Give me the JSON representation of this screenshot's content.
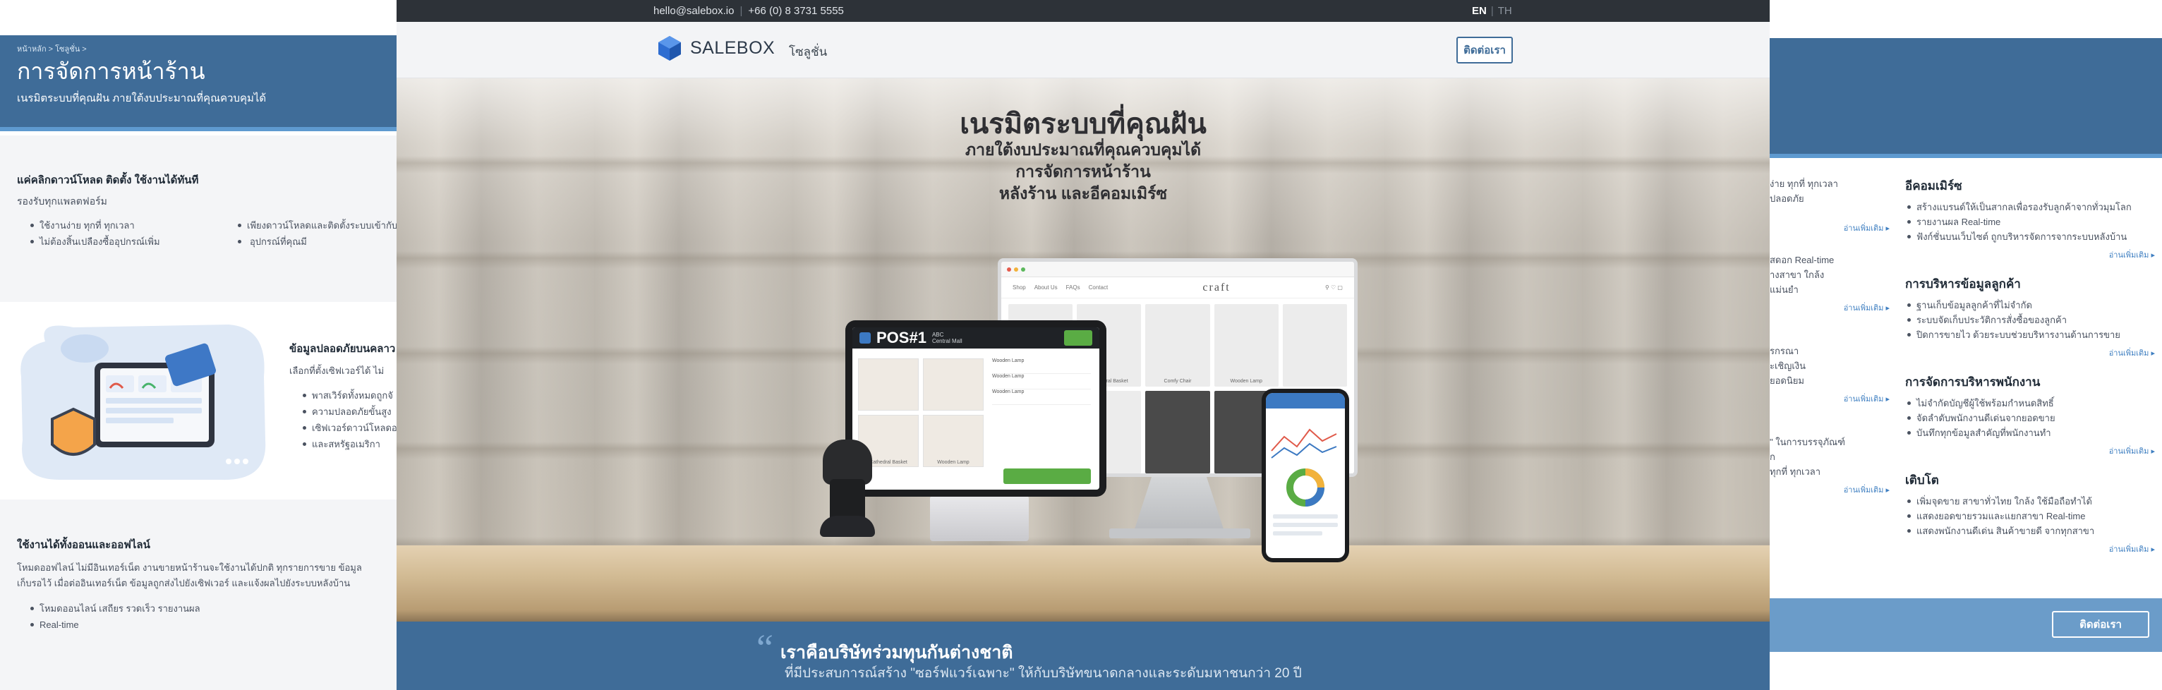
{
  "left_panel": {
    "breadcrumb": "หน้าหลัก > โซลูชั่น >",
    "title": "การจัดการหน้าร้าน",
    "subtitle": "เนรมิตระบบที่คุณฝัน ภายใต้งบประมาณที่คุณควบคุมได้",
    "section1": {
      "heading": "แค่คลิกดาวน์โหลด ติดตั้ง ใช้งานได้ทันที",
      "intro": "รองรับทุกแพลตฟอร์ม",
      "bullets_col1": [
        "ใช้งานง่าย ทุกที่ ทุกเวลา",
        "ไม่ต้องสิ้นเปลืองซื้ออุปกรณ์เพิ่ม"
      ],
      "bullets_col2": [
        "เพียงดาวน์โหลดและติดตั้งระบบเข้ากับ",
        "อุปกรณ์ที่คุณมี"
      ]
    },
    "section2": {
      "heading": "ข้อมูลปลอดภัยบนคลาว",
      "intro": "เลือกที่ตั้งเซิฟเวอร์ได้ ไม่",
      "bullets": [
        "พาสเวิร์ดทั้งหมดถูกจั",
        "ความปลอดภัยขั้นสูง",
        "เซิฟเวอร์ดาวน์โหลดอ",
        "และสหรัฐอเมริกา"
      ]
    },
    "section3": {
      "heading": "ใช้งานได้ทั้งออนและออฟไลน์",
      "line1": "โหมดออฟไลน์ ไม่มีอินเทอร์เน็ต งานขายหน้าร้านจะใช้งานได้ปกติ ทุกรายการขาย ข้อมูล",
      "line2": "เก็บรอไว้ เมื่อต่ออินเทอร์เน็ต ข้อมูลถูกส่งไปยังเซิฟเวอร์ และแจ้งผลไปยังระบบหลังบ้าน",
      "bullet1": "โหมดออนไลน์ เสถียร รวดเร็ว รายงานผล",
      "bullet2": "Real-time"
    }
  },
  "topbar": {
    "email": "hello@salebox.io",
    "phone": "+66 (0) 8 3731 5555",
    "lang_en": "EN",
    "lang_th": "TH"
  },
  "navbar": {
    "logo_text": "SALEBOX",
    "menu_solutions": "โซลูชั่น",
    "contact_button": "ติดต่อเรา"
  },
  "hero": {
    "title": "เนรมิตระบบที่คุณฝัน",
    "line1": "ภายใต้งบประมาณที่คุณควบคุมได้",
    "line2": "การจัดการหน้าร้าน",
    "line3": "หลังร้าน และอีคอมเมิร์ซ",
    "pos_label": "POS#1",
    "pos_sub1": "ABC",
    "pos_sub2": "Central Mall",
    "shop_brand": "craft",
    "shop_nav": [
      "Shop",
      "About Us",
      "FAQs",
      "Contact"
    ],
    "shop_items": [
      "Cathedral Basket",
      "Comfy Chair",
      "Wooden Lamp"
    ],
    "pos_items": [
      "Cathedral Basket",
      "Wooden Lamp"
    ],
    "side_items": [
      "Wooden Lamp",
      "Wooden Lamp",
      "Wooden Lamp"
    ]
  },
  "quote": {
    "mark": "“",
    "line1": "เราคือบริษัทร่วมทุนกันต่างชาติ",
    "line2": "ที่มีประสบการณ์สร้าง \"ซอร์ฟแวร์เฉพาะ\" ให้กับบริษัทขนาดกลางและระดับมหาชนกว่า 20 ปี"
  },
  "right_panel": {
    "partial_col": {
      "lines_a": [
        "ง่าย ทุกที่ ทุกเวลา",
        "ปลอดภัย"
      ],
      "more_a": "อ่านเพิ่มเติม",
      "lines_b": [
        "สดอก Real-time",
        "างสาขา ใกล้ง",
        "แม่นยำ"
      ],
      "more_b": "อ่านเพิ่มเติม",
      "lines_c": [
        "รกรณา",
        "ะเชิญเงิน",
        "ยอดนิยม"
      ],
      "more_c": "อ่านเพิ่มเติม",
      "lines_d": [
        "\" ในการบรรจุภัณฑ์",
        "ก",
        "ทุกที่ ทุกเวลา"
      ],
      "more_d": "อ่านเพิ่มเติม"
    },
    "ecommerce": {
      "heading": "อีคอมเมิร์ซ",
      "bullets": [
        "สร้างแบรนด์ให้เป็นสากลเพื่อรองรับลูกค้าจากทั่วมุมโลก",
        "รายงานผล Real-time",
        "ฟังก์ชั่นบนเว็บไซต์ ถูกบริหารจัดการจากระบบหลังบ้าน"
      ],
      "more": "อ่านเพิ่มเติม"
    },
    "crm": {
      "heading": "การบริหารข้อมูลลูกค้า",
      "bullets": [
        "ฐานเก็บข้อมูลลูกค้าที่ไม่จำกัด",
        "ระบบจัดเก็บประวัติการสั่งซื้อของลูกค้า",
        "ปิดการขายไว ด้วยระบบช่วยบริหารงานด้านการขาย"
      ],
      "more": "อ่านเพิ่มเติม"
    },
    "hr": {
      "heading": "การจัดการบริหารพนักงาน",
      "bullets": [
        "ไม่จำกัดบัญชีผู้ใช้พร้อมกำหนดสิทธิ์",
        "จัดลำดับพนักงานดีเด่นจากยอดขาย",
        "บันทึกทุกข้อมูลสำคัญที่พนักงานทำ"
      ],
      "more": "อ่านเพิ่มเติม"
    },
    "growth": {
      "heading": "เติบโต",
      "bullets": [
        "เพิ่มจุดขาย สาขาทั่วไทย ใกล้ง ใช้มือถือทำได้",
        "แสดงยอดขายรวมและแยกสาขา Real-time",
        "แสดงพนักงานดีเด่น สินค้าขายดี จากทุกสาขา"
      ],
      "more": "อ่านเพิ่มเติม"
    },
    "contact_button": "ติดต่อเรา"
  },
  "colors": {
    "brand_blue": "#3f6c98",
    "topbar": "#2d3238",
    "accent_green": "#5aac44"
  }
}
